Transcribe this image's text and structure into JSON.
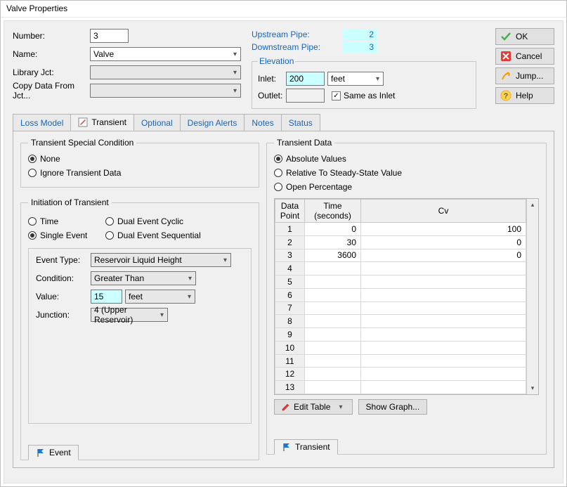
{
  "window_title": "Valve Properties",
  "top_form": {
    "number_label": "Number:",
    "number_value": "3",
    "name_label": "Name:",
    "name_value": "Valve",
    "library_label": "Library Jct:",
    "library_value": "",
    "copy_label": "Copy Data From Jct...",
    "copy_value": ""
  },
  "pipes": {
    "upstream_label": "Upstream Pipe:",
    "upstream_value": "2",
    "downstream_label": "Downstream Pipe:",
    "downstream_value": "3"
  },
  "elevation": {
    "legend": "Elevation",
    "inlet_label": "Inlet:",
    "inlet_value": "200",
    "inlet_unit": "feet",
    "outlet_label": "Outlet:",
    "outlet_value": "",
    "same_label": "Same as Inlet"
  },
  "buttons": {
    "ok": "OK",
    "cancel": "Cancel",
    "jump": "Jump...",
    "help": "Help"
  },
  "tabs": {
    "loss_model": "Loss Model",
    "transient": "Transient",
    "optional": "Optional",
    "design_alerts": "Design Alerts",
    "notes": "Notes",
    "status": "Status"
  },
  "special_cond": {
    "legend": "Transient Special Condition",
    "none": "None",
    "ignore": "Ignore Transient Data"
  },
  "initiation": {
    "legend": "Initiation of Transient",
    "time": "Time",
    "single_event": "Single Event",
    "dual_cyclic": "Dual Event Cyclic",
    "dual_seq": "Dual Event Sequential"
  },
  "event": {
    "type_label": "Event Type:",
    "type_value": "Reservoir Liquid Height",
    "cond_label": "Condition:",
    "cond_value": "Greater Than",
    "value_label": "Value:",
    "value_value": "15",
    "value_unit": "feet",
    "junction_label": "Junction:",
    "junction_value": "4 (Upper Reservoir)",
    "tab_label": "Event"
  },
  "trans_data": {
    "legend": "Transient Data",
    "absolute": "Absolute Values",
    "relative": "Relative To Steady-State Value",
    "open_pct": "Open Percentage",
    "headers": {
      "dp": "Data Point",
      "time": "Time (seconds)",
      "cv": "Cv"
    },
    "rows": [
      {
        "n": "1",
        "t": "0",
        "c": "100"
      },
      {
        "n": "2",
        "t": "30",
        "c": "0"
      },
      {
        "n": "3",
        "t": "3600",
        "c": "0"
      },
      {
        "n": "4",
        "t": "",
        "c": ""
      },
      {
        "n": "5",
        "t": "",
        "c": ""
      },
      {
        "n": "6",
        "t": "",
        "c": ""
      },
      {
        "n": "7",
        "t": "",
        "c": ""
      },
      {
        "n": "8",
        "t": "",
        "c": ""
      },
      {
        "n": "9",
        "t": "",
        "c": ""
      },
      {
        "n": "10",
        "t": "",
        "c": ""
      },
      {
        "n": "11",
        "t": "",
        "c": ""
      },
      {
        "n": "12",
        "t": "",
        "c": ""
      },
      {
        "n": "13",
        "t": "",
        "c": ""
      }
    ],
    "edit_table": "Edit Table",
    "show_graph": "Show Graph...",
    "tab_label": "Transient"
  }
}
